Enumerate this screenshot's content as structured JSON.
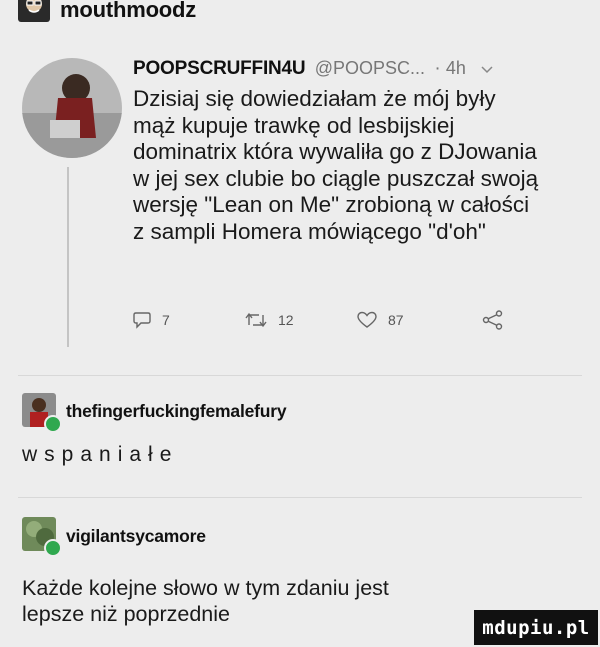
{
  "header": {
    "username": "mouthmoodz"
  },
  "tweet": {
    "handle": "POOPSCRUFFIN4U",
    "at_handle": "@POOPSC...",
    "separator": "·",
    "time": "4h",
    "text_lines": [
      "Dzisiaj się dowiedziałam że mój były",
      "mąż kupuje trawkę od lesbijskiej",
      "dominatrix która wywaliła go z DJowania",
      "w jej sex clubie bo ciągle puszczał swoją",
      "wersję \"Lean on Me\" zrobioną w całości",
      "z sampli Homera mówiącego \"d'oh\""
    ],
    "replies": "7",
    "retweets": "12",
    "likes": "87",
    "reply_icon": "speech-bubble-icon",
    "retweet_icon": "retweet-icon",
    "like_icon": "heart-icon",
    "share_icon": "share-icon"
  },
  "comments": [
    {
      "username": "thefingerfuckingfemalefury",
      "text": "wspaniałe"
    },
    {
      "username": "vigilantsycamore",
      "text_lines": [
        "Każde kolejne słowo w tym zdaniu jest",
        "lepsze niż poprzednie"
      ]
    }
  ],
  "watermark": {
    "text": "mdupiu.pl"
  },
  "colors": {
    "background": "#ededed",
    "badge": "#2fa84f"
  }
}
